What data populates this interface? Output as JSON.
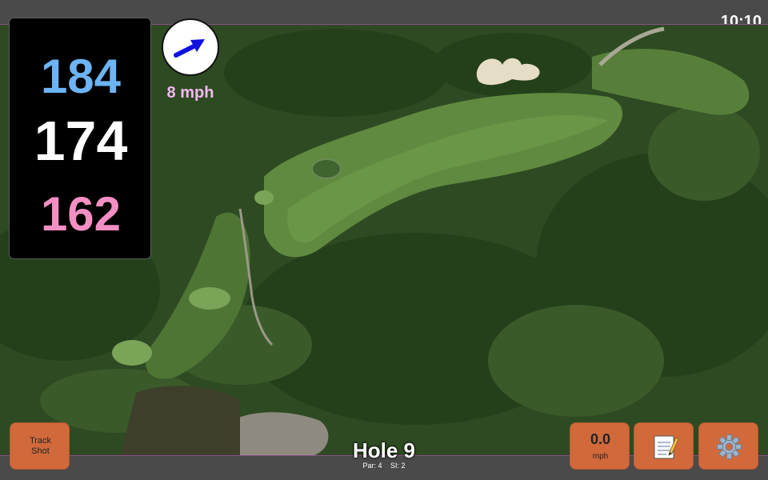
{
  "status_bar": {
    "clock": "10:10"
  },
  "distances": {
    "back": "184",
    "middle": "174",
    "front": "162",
    "colors": {
      "back": "#6cb4f5",
      "middle": "#ffffff",
      "front": "#f48fc4"
    }
  },
  "wind": {
    "speed_label": "8 mph",
    "arrow_icon": "wind-direction-arrow-icon",
    "arrow_color": "#1010e0"
  },
  "track_shot": {
    "label": "Track\nShot"
  },
  "speed_button": {
    "value": "0.0",
    "unit": "mph"
  },
  "notes_button": {
    "icon": "notepad-icon"
  },
  "settings_button": {
    "icon": "gear-icon"
  },
  "hole": {
    "title": "Hole 9",
    "par": "Par: 4",
    "si": "SI: 2"
  },
  "theme": {
    "button_color": "#d2693b",
    "map_border": "#8a4d8a"
  }
}
